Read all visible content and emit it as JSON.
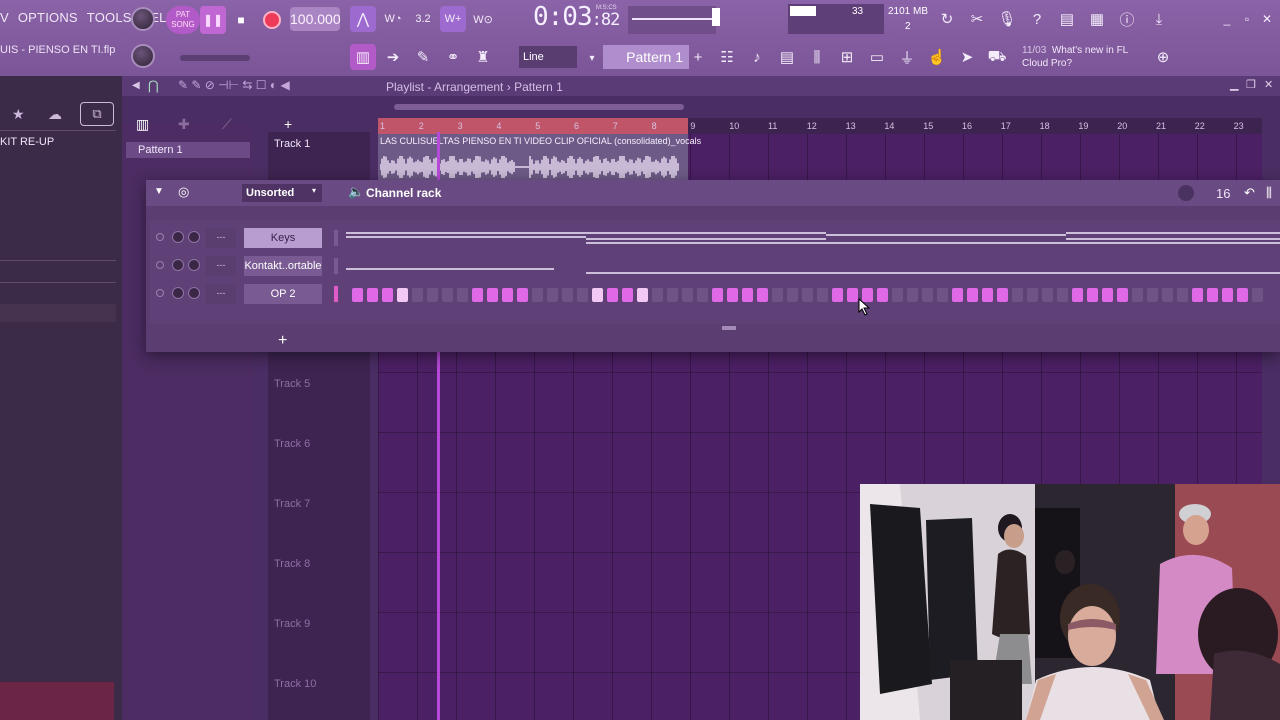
{
  "menu": {
    "items": [
      "V",
      "OPTIONS",
      "TOOLS",
      "HELP"
    ]
  },
  "transport": {
    "pattern_label": "PAT",
    "song_label": "SONG",
    "tempo": "100.000",
    "time": "0:03",
    "time_fraction": "82",
    "time_unit": "M:S:CS"
  },
  "monitor": {
    "cpu": "33",
    "memory": "2101 MB",
    "polyphony": "2"
  },
  "project": {
    "name": "UIS - PIENSO EN TI.flp"
  },
  "toolbar": {
    "snap": "Line",
    "pattern": "Pattern 1",
    "news_date": "11/03",
    "news_text_1": "What's new in FL",
    "news_text_2": "Cloud Pro?"
  },
  "browser": {
    "item": "KIT RE-UP"
  },
  "playlist": {
    "title": "Playlist - Arrangement",
    "title_sep": "›",
    "title_pattern": "Pattern 1",
    "pattern_item": "Pattern 1",
    "tracks": [
      "Track 1",
      "Track 5",
      "Track 6",
      "Track 7",
      "Track 8",
      "Track 9",
      "Track 10"
    ],
    "ruler": [
      "1",
      "2",
      "3",
      "4",
      "5",
      "6",
      "7",
      "8",
      "9",
      "10",
      "11",
      "12",
      "13",
      "14",
      "15",
      "16",
      "17",
      "18",
      "19",
      "20",
      "21",
      "22",
      "23"
    ],
    "clip_title": "LAS CULISUELTAS PIENSO EN TI VIDEO CLIP OFICIAL (consolidated)_vocals"
  },
  "channel_rack": {
    "filter": "Unsorted",
    "title": "Channel rack",
    "steps": "16",
    "route_label": "---",
    "channels": [
      {
        "name": "Keys",
        "selected": true
      },
      {
        "name": "Kontakt..ortable",
        "selected": false
      },
      {
        "name": "OP 2",
        "selected": false
      }
    ],
    "op2_steps": [
      1,
      1,
      1,
      2,
      0,
      0,
      0,
      0,
      1,
      1,
      1,
      1,
      0,
      0,
      0,
      0,
      2,
      1,
      1,
      2,
      0,
      0,
      0,
      0,
      1,
      1,
      1,
      1,
      0,
      0,
      0,
      0,
      1,
      1,
      1,
      1,
      0,
      0,
      0,
      0,
      1,
      1,
      1,
      1,
      0,
      0,
      0,
      0,
      1,
      1,
      1,
      1,
      0,
      0,
      0,
      0,
      1,
      1,
      1,
      1,
      0,
      0,
      0,
      0
    ]
  },
  "colors": {
    "accent": "#df69e6",
    "record": "#f03a5a",
    "loop": "#c05569",
    "background": "#4a2f62"
  },
  "icons": [
    "pause-icon",
    "stop-icon",
    "record-icon",
    "metronome-icon",
    "undo-icon",
    "cut-icon",
    "mic-icon",
    "help-icon",
    "save-icon",
    "info-icon",
    "download-icon",
    "minimize-icon",
    "restore-icon",
    "close-icon"
  ]
}
